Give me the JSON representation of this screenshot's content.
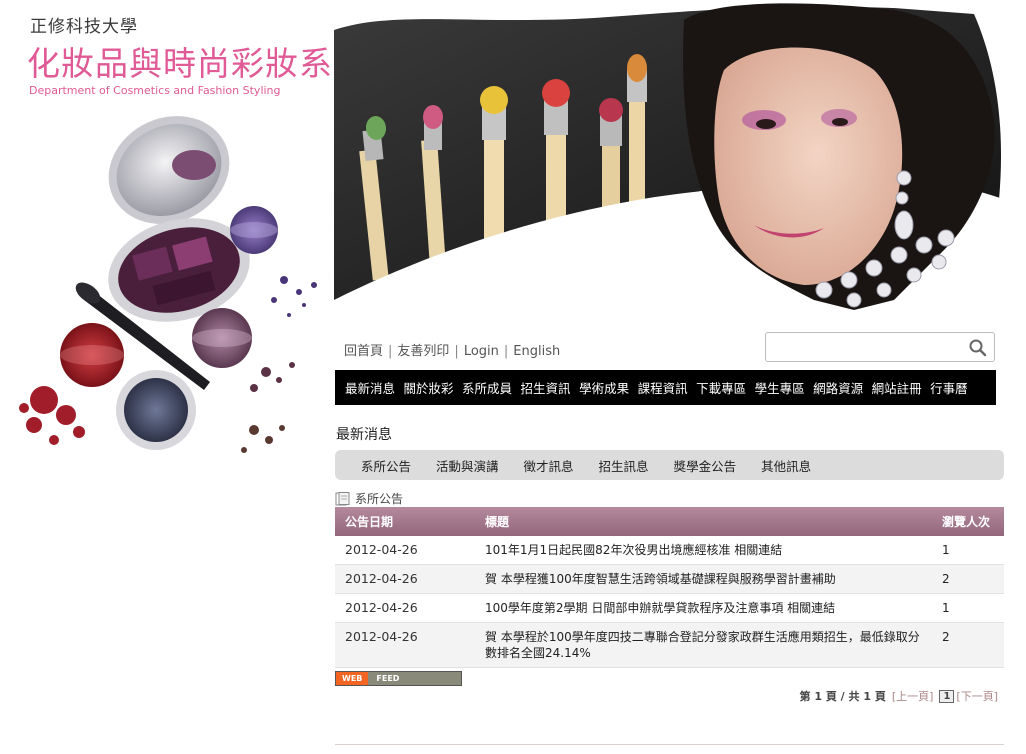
{
  "header": {
    "school_name": "正修科技大學",
    "department_zh": "化妝品與時尚彩妝系",
    "department_en": "Department  of Cosmetics and Fashion Styling"
  },
  "toplinks": {
    "home": "回首頁",
    "print": "友善列印",
    "login": "Login",
    "english": "English",
    "separator": "|"
  },
  "search": {
    "placeholder": "",
    "icon": "search-icon"
  },
  "nav": [
    "最新消息",
    "關於妝彩",
    "系所成員",
    "招生資訊",
    "學術成果",
    "課程資訊",
    "下載專區",
    "學生專區",
    "網路資源",
    "網站註冊",
    "行事曆"
  ],
  "news": {
    "title": "最新消息",
    "tabs": [
      "系所公告",
      "活動與演講",
      "徵才訊息",
      "招生訊息",
      "獎學金公告",
      "其他訊息"
    ],
    "caption": "系所公告",
    "columns": {
      "date": "公告日期",
      "title": "標題",
      "views": "瀏覽人次"
    },
    "rows": [
      {
        "date": "2012-04-26",
        "title": "101年1月1日起民國82年次役男出境應經核准 相關連結",
        "views": "1"
      },
      {
        "date": "2012-04-26",
        "title": "賀 本學程獲100年度智慧生活跨領域基礎課程與服務學習計畫補助",
        "views": "2"
      },
      {
        "date": "2012-04-26",
        "title": "100學年度第2學期 日間部申辦就學貸款程序及注意事項 相關連結",
        "views": "1"
      },
      {
        "date": "2012-04-26",
        "title": "賀 本學程於100學年度四技二專聯合登記分發家政群生活應用類招生，最低錄取分數排名全國24.14%",
        "views": "2"
      }
    ]
  },
  "feed": {
    "web": "WEB",
    "feed": "FEED"
  },
  "pager": {
    "summary": "第 1 頁 / 共 1 頁",
    "prev": "[上一頁]",
    "current": "1",
    "next": "[下一頁]"
  },
  "colors": {
    "brand_pink": "#e05a95",
    "nav_bg": "#000000",
    "table_header": "#a07488",
    "tab_bar": "#dcdcdc",
    "feed_orange": "#f26522"
  }
}
